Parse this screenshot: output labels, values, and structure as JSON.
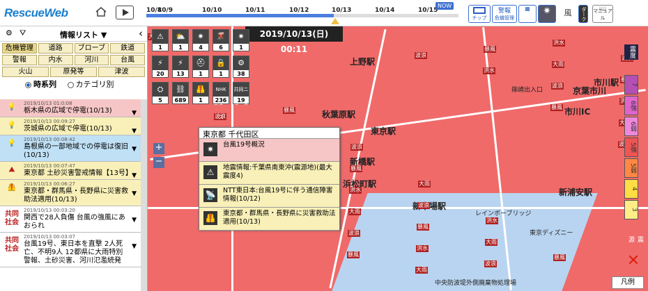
{
  "app": {
    "title": "RescueWeb"
  },
  "timeline": {
    "ticks": [
      "10/8",
      "10/9",
      "10/10",
      "10/11",
      "10/12",
      "10/13",
      "10/14",
      "10/15"
    ],
    "now_label": "NOW",
    "progress": 0.6
  },
  "toolbar": {
    "chip_label": "チップ",
    "alert_label": "警報",
    "alert_sub": "危機管理",
    "wind_label": "風",
    "dark_label": "ダーク",
    "manual_label": "マニュアル"
  },
  "datetime": "2019/10/13(日) 00:11",
  "panel": {
    "title": "情報リスト ▼",
    "categories": [
      "危機管理",
      "道路",
      "ブローブ",
      "鉄道",
      "警報",
      "内水",
      "河川",
      "台風"
    ],
    "categories2": [
      "火山",
      "原発等",
      "津波"
    ],
    "radio_time": "時系列",
    "radio_cat": "カテゴリ別"
  },
  "items": [
    {
      "time": "2019/10/13 01:0:08",
      "text": "栃木県の広域で停電(10/13)",
      "icon": "bulb-icon",
      "bg": "#f6c6c6"
    },
    {
      "time": "2019/10/13 00:09:27",
      "text": "茨城県の広域で停電(10/13)",
      "icon": "bulb-icon",
      "bg": "#f8f0b8"
    },
    {
      "time": "2019/10/13 00:08:42",
      "text": "島根県の一部地域での停電は復旧(10/13)",
      "icon": "bulb-icon",
      "bg": "#bfe0f5"
    },
    {
      "time": "2019/10/13 00:07:47",
      "text": "東京都 土砂災害警戒情報【13号】",
      "icon": "landslide-icon",
      "bg": "#f8f0b8"
    },
    {
      "time": "2019/10/13 00:06:27",
      "text": "東京都・群馬県・長野県に災害救助法適用(10/13)",
      "icon": "vest-icon",
      "bg": "#f8f0b8"
    },
    {
      "time": "2019/10/13 00:03:20",
      "text": "関西で28人負傷 台風の強風にあおられ",
      "icon": "共同社会",
      "bg": "#ffffff"
    },
    {
      "time": "2019/10/13 00:03:07",
      "text": "台風19号、東日本を直撃 2人死亡、不明9人 12都県に大雨特別警報、土砂災害、河川氾濫続発",
      "icon": "共同社会",
      "bg": "#ffffff"
    }
  ],
  "iconcounts": [
    "1",
    "1",
    "4",
    "6",
    "1",
    "20",
    "13",
    "1",
    "1",
    "38",
    "5",
    "689",
    "1",
    "236",
    "19"
  ],
  "iconlabels": [
    "",
    "",
    "",
    "",
    "",
    "",
    "",
    "",
    "",
    "",
    "",
    "",
    "",
    "NHKニュース",
    "共同ニュース"
  ],
  "popup": {
    "title": "東京都 千代田区",
    "rows": [
      "台風19号概況",
      "地震情報:千葉県南東沖(震源地)(最大震度4)",
      "NTT東日本:台風19号に伴う通信障害情報(10/12)",
      "東京都・群馬県・長野県に災害救助法適用(10/13)"
    ]
  },
  "map": {
    "places": [
      "上野駅",
      "秋葉原駅",
      "東京駅",
      "新橋駅",
      "浜松町駅",
      "新木場駅",
      "新浦安駅",
      "市川駅",
      "京葉市川",
      "市川IC",
      "篠崎出入口",
      "東京ディズニー",
      "中央防波堤外側廃棄物処理場",
      "レインボーブリッジ"
    ],
    "labels_b": [
      "大雨",
      "洪水",
      "暴風",
      "波浪"
    ]
  },
  "seismic": {
    "title": "震度",
    "levels": [
      "7",
      "6強",
      "6弱",
      "5強",
      "5弱",
      "4",
      "3"
    ],
    "source_label": "震源"
  },
  "legend_label": "凡例"
}
